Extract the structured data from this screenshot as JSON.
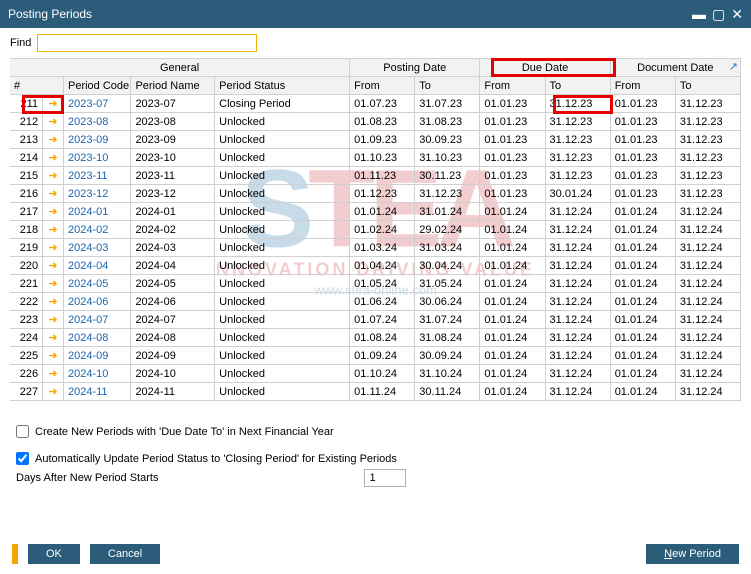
{
  "window": {
    "title": "Posting Periods"
  },
  "find": {
    "label": "Find",
    "value": ""
  },
  "groupHeaders": {
    "general": "General",
    "posting": "Posting Date",
    "due": "Due Date",
    "doc": "Document Date"
  },
  "cols": {
    "idx": "#",
    "code": "Period Code",
    "name": "Period Name",
    "status": "Period Status",
    "from": "From",
    "to": "To"
  },
  "rows": [
    {
      "idx": "211",
      "code": "2023-07",
      "name": "2023-07",
      "status": "Closing Period",
      "pf": "01.07.23",
      "pt": "31.07.23",
      "df": "01.01.23",
      "dt": "31.12.23",
      "docf": "01.01.23",
      "doct": "31.12.23"
    },
    {
      "idx": "212",
      "code": "2023-08",
      "name": "2023-08",
      "status": "Unlocked",
      "pf": "01.08.23",
      "pt": "31.08.23",
      "df": "01.01.23",
      "dt": "31.12.23",
      "docf": "01.01.23",
      "doct": "31.12.23"
    },
    {
      "idx": "213",
      "code": "2023-09",
      "name": "2023-09",
      "status": "Unlocked",
      "pf": "01.09.23",
      "pt": "30.09.23",
      "df": "01.01.23",
      "dt": "31.12.23",
      "docf": "01.01.23",
      "doct": "31.12.23"
    },
    {
      "idx": "214",
      "code": "2023-10",
      "name": "2023-10",
      "status": "Unlocked",
      "pf": "01.10.23",
      "pt": "31.10.23",
      "df": "01.01.23",
      "dt": "31.12.23",
      "docf": "01.01.23",
      "doct": "31.12.23"
    },
    {
      "idx": "215",
      "code": "2023-11",
      "name": "2023-11",
      "status": "Unlocked",
      "pf": "01.11.23",
      "pt": "30.11.23",
      "df": "01.01.23",
      "dt": "31.12.23",
      "docf": "01.01.23",
      "doct": "31.12.23"
    },
    {
      "idx": "216",
      "code": "2023-12",
      "name": "2023-12",
      "status": "Unlocked",
      "pf": "01.12.23",
      "pt": "31.12.23",
      "df": "01.01.23",
      "dt": "30.01.24",
      "docf": "01.01.23",
      "doct": "31.12.23"
    },
    {
      "idx": "217",
      "code": "2024-01",
      "name": "2024-01",
      "status": "Unlocked",
      "pf": "01.01.24",
      "pt": "31.01.24",
      "df": "01.01.24",
      "dt": "31.12.24",
      "docf": "01.01.24",
      "doct": "31.12.24"
    },
    {
      "idx": "218",
      "code": "2024-02",
      "name": "2024-02",
      "status": "Unlocked",
      "pf": "01.02.24",
      "pt": "29.02.24",
      "df": "01.01.24",
      "dt": "31.12.24",
      "docf": "01.01.24",
      "doct": "31.12.24"
    },
    {
      "idx": "219",
      "code": "2024-03",
      "name": "2024-03",
      "status": "Unlocked",
      "pf": "01.03.24",
      "pt": "31.03.24",
      "df": "01.01.24",
      "dt": "31.12.24",
      "docf": "01.01.24",
      "doct": "31.12.24"
    },
    {
      "idx": "220",
      "code": "2024-04",
      "name": "2024-04",
      "status": "Unlocked",
      "pf": "01.04.24",
      "pt": "30.04.24",
      "df": "01.01.24",
      "dt": "31.12.24",
      "docf": "01.01.24",
      "doct": "31.12.24"
    },
    {
      "idx": "221",
      "code": "2024-05",
      "name": "2024-05",
      "status": "Unlocked",
      "pf": "01.05.24",
      "pt": "31.05.24",
      "df": "01.01.24",
      "dt": "31.12.24",
      "docf": "01.01.24",
      "doct": "31.12.24"
    },
    {
      "idx": "222",
      "code": "2024-06",
      "name": "2024-06",
      "status": "Unlocked",
      "pf": "01.06.24",
      "pt": "30.06.24",
      "df": "01.01.24",
      "dt": "31.12.24",
      "docf": "01.01.24",
      "doct": "31.12.24"
    },
    {
      "idx": "223",
      "code": "2024-07",
      "name": "2024-07",
      "status": "Unlocked",
      "pf": "01.07.24",
      "pt": "31.07.24",
      "df": "01.01.24",
      "dt": "31.12.24",
      "docf": "01.01.24",
      "doct": "31.12.24"
    },
    {
      "idx": "224",
      "code": "2024-08",
      "name": "2024-08",
      "status": "Unlocked",
      "pf": "01.08.24",
      "pt": "31.08.24",
      "df": "01.01.24",
      "dt": "31.12.24",
      "docf": "01.01.24",
      "doct": "31.12.24"
    },
    {
      "idx": "225",
      "code": "2024-09",
      "name": "2024-09",
      "status": "Unlocked",
      "pf": "01.09.24",
      "pt": "30.09.24",
      "df": "01.01.24",
      "dt": "31.12.24",
      "docf": "01.01.24",
      "doct": "31.12.24"
    },
    {
      "idx": "226",
      "code": "2024-10",
      "name": "2024-10",
      "status": "Unlocked",
      "pf": "01.10.24",
      "pt": "31.10.24",
      "df": "01.01.24",
      "dt": "31.12.24",
      "docf": "01.01.24",
      "doct": "31.12.24"
    },
    {
      "idx": "227",
      "code": "2024-11",
      "name": "2024-11",
      "status": "Unlocked",
      "pf": "01.11.24",
      "pt": "30.11.24",
      "df": "01.01.24",
      "dt": "31.12.24",
      "docf": "01.01.24",
      "doct": "31.12.24"
    }
  ],
  "options": {
    "createNew": "Create New Periods with 'Due Date To' in Next Financial Year",
    "autoUpdate": "Automatically Update Period Status to 'Closing Period' for Existing Periods",
    "daysLabel": "Days After New Period Starts",
    "daysValue": "1"
  },
  "buttons": {
    "ok": "OK",
    "cancel": "Cancel",
    "newPeriod_pre": "N",
    "newPeriod_post": "ew Period"
  }
}
